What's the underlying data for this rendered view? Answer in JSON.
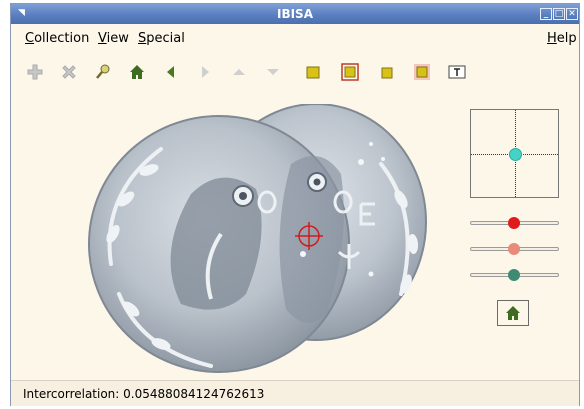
{
  "window": {
    "title": "IBISA"
  },
  "menu": {
    "collection": {
      "first": "C",
      "rest": "ollection"
    },
    "view": {
      "first": "V",
      "rest": "iew"
    },
    "special": {
      "first": "S",
      "rest": "pecial"
    },
    "help": {
      "first": "H",
      "rest": "elp"
    }
  },
  "toolbar": {
    "icons": [
      "plus-icon",
      "delete-icon",
      "search-icon",
      "home-icon",
      "back-icon",
      "forward-icon",
      "up-icon",
      "down-icon",
      "square-icon",
      "square-outlined-icon",
      "square-small-icon",
      "square-highlight-icon",
      "text-icon"
    ]
  },
  "controls": {
    "pad_knob_color": "#45d3c8",
    "slider_colors": [
      "#e01b1b",
      "#e88a7c",
      "#3f8a72"
    ]
  },
  "status": {
    "text": "Intercorrelation: 0.05488084124762613"
  }
}
